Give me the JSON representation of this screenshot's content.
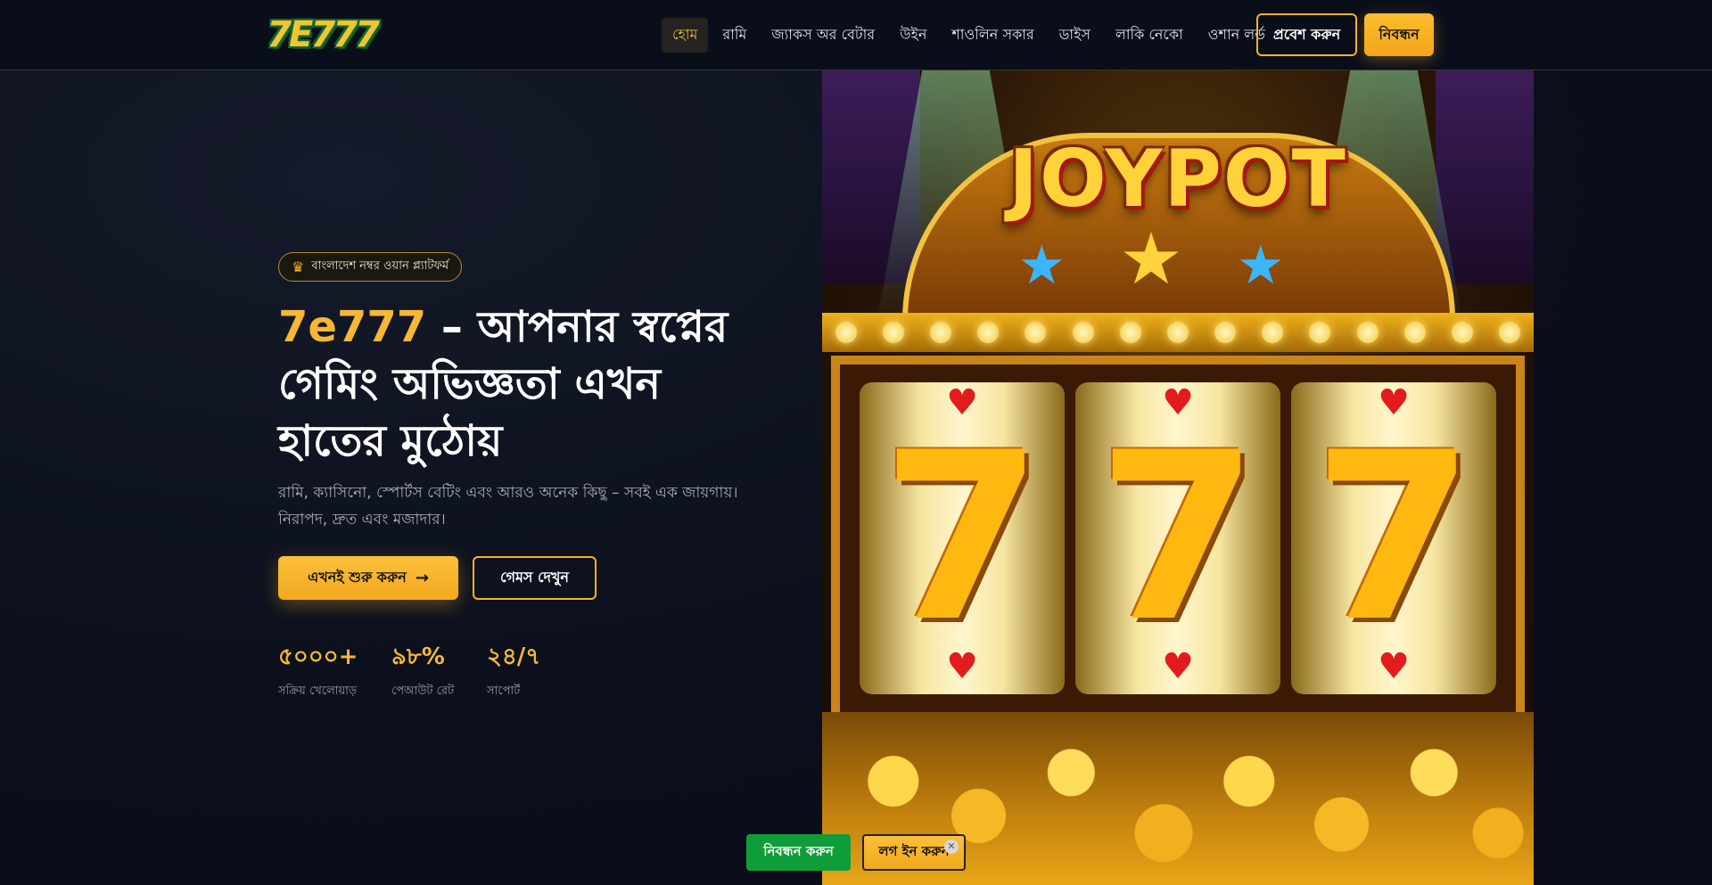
{
  "header": {
    "logo_text": "7E777",
    "nav": [
      {
        "label": "হোম",
        "active": true
      },
      {
        "label": "রামি",
        "active": false
      },
      {
        "label": "জ্যাকস অর বেটার",
        "active": false
      },
      {
        "label": "উইন",
        "active": false
      },
      {
        "label": "শাওলিন সকার",
        "active": false
      },
      {
        "label": "ডাইস",
        "active": false
      },
      {
        "label": "লাকি নেকো",
        "active": false
      },
      {
        "label": "ওশান লর্ড",
        "active": false
      }
    ],
    "login_label": "প্রবেশ করুন",
    "register_label": "নিবন্ধন"
  },
  "hero": {
    "badge_icon": "crown-icon",
    "badge_text": "বাংলাদেশ নম্বর ওয়ান প্ল্যাটফর্ম",
    "title_brand": "7e777",
    "title_rest": " – আপনার স্বপ্নের গেমিং অভিজ্ঞতা এখন হাতের মুঠোয়",
    "subtitle": "রামি, ক্যাসিনো, স্পোর্টস বেটিং এবং আরও অনেক কিছু – সবই এক জায়গায়। নিরাপদ, দ্রুত এবং মজাদার।",
    "start_label": "এখনই শুরু করুন",
    "start_icon": "arrow-right-icon",
    "games_label": "গেমস দেখুন",
    "stats": [
      {
        "value": "৫০০০+",
        "label": "সক্রিয় খেলোয়াড়"
      },
      {
        "value": "৯৮%",
        "label": "পেআউট রেট"
      },
      {
        "value": "২৪/৭",
        "label": "সাপোর্ট"
      }
    ]
  },
  "hero_image": {
    "banner_text": "JOYPOT",
    "reel_symbol": "7"
  },
  "sticky_bar": {
    "register_label": "নিবন্ধন করুন",
    "login_label": "লগ ইন করুন",
    "close_icon": "close-icon"
  },
  "colors": {
    "accent": "#f6b734",
    "background": "#0b0f1b",
    "sticky_register": "#0f9d3a"
  }
}
